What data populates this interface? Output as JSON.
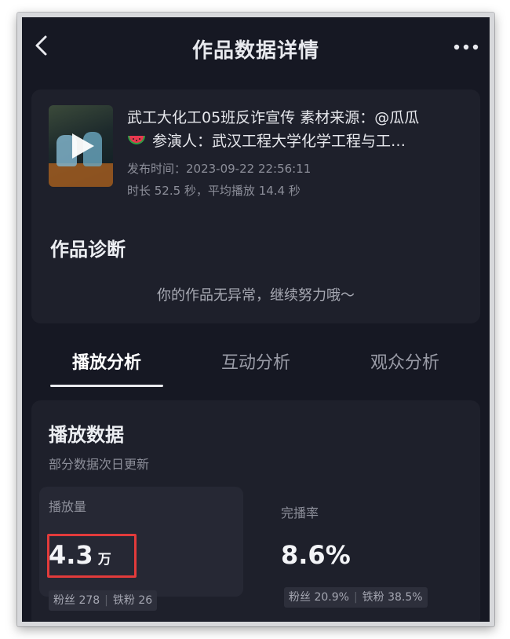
{
  "header": {
    "title": "作品数据详情"
  },
  "video": {
    "title_line1": "武工大化工05班反诈宣传 素材来源：@瓜瓜",
    "title_line2": "参演人：武汉工程大学化学工程与工…",
    "publish_time": "发布时间：2023-09-22 22:56:11",
    "duration_info": "时长 52.5 秒，平均播放 14.4 秒"
  },
  "diagnosis": {
    "title": "作品诊断",
    "message": "你的作品无异常，继续努力哦～"
  },
  "tabs": [
    {
      "label": "播放分析",
      "active": true
    },
    {
      "label": "互动分析",
      "active": false
    },
    {
      "label": "观众分析",
      "active": false
    }
  ],
  "play_data": {
    "title": "播放数据",
    "subtitle": "部分数据次日更新",
    "views": {
      "label": "播放量",
      "value": "4.3",
      "unit": "万",
      "fans": "粉丝 278",
      "iron_fans": "铁粉 26"
    },
    "completion": {
      "label": "完播率",
      "value": "8.6%",
      "fans": "粉丝 20.9%",
      "iron_fans": "铁粉 38.5%"
    }
  },
  "colors": {
    "background": "#161823",
    "card": "#1e202b",
    "highlight_border": "#e23b3b"
  },
  "icons": [
    "chevron-left-icon",
    "more-dots-icon",
    "play-icon",
    "watermelon-icon"
  ]
}
